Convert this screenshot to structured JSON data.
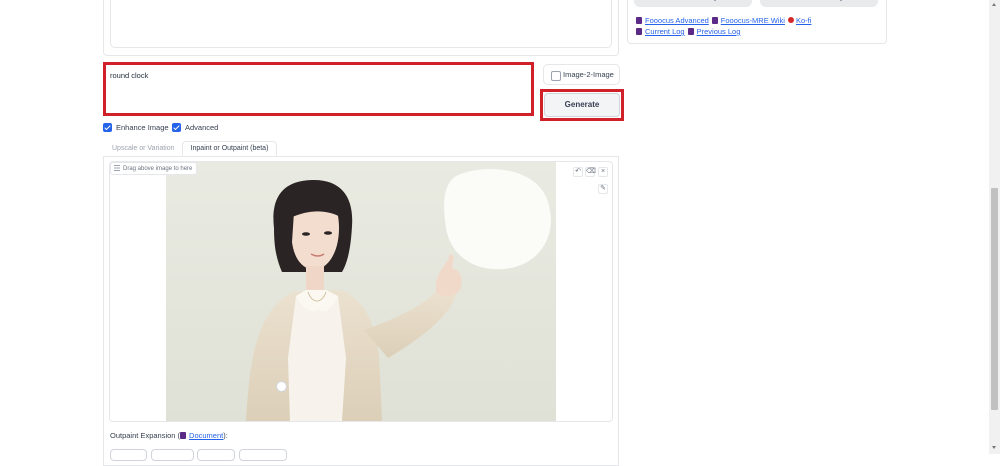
{
  "prompt": {
    "value": "round clock"
  },
  "image2image": {
    "label": "Image-2-Image",
    "checked": false
  },
  "generate": {
    "label": "Generate"
  },
  "options": {
    "enhance_image": {
      "label": "Enhance Image",
      "checked": true
    },
    "advanced": {
      "label": "Advanced",
      "checked": true
    }
  },
  "tabs": [
    {
      "label": "Upscale or Variation",
      "active": false
    },
    {
      "label": "Inpaint or Outpaint (beta)",
      "active": true
    }
  ],
  "canvas": {
    "drag_label": "Drag above image to here",
    "tool_icons": [
      "undo-icon",
      "clear-icon",
      "close-icon",
      "brush-icon"
    ],
    "image": "woman in cardigan pointing up at a white round masked area"
  },
  "outpaint": {
    "label_prefix": "Outpaint Expansion (",
    "link": "Document",
    "label_suffix": "):"
  },
  "links": {
    "row1": [
      "Fooocus Advanced",
      "Fooocus-MRE Wiki",
      "Ko-fi"
    ],
    "row2": [
      "Current Log",
      "Previous Log"
    ]
  },
  "colors": {
    "highlight": "#d0202a",
    "checkbox": "#2563eb",
    "link": "#2563eb",
    "book_icon": "#5b2a86"
  }
}
